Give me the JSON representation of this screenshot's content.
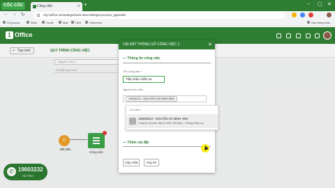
{
  "browser": {
    "brand": "CỐC CỐC",
    "tab_title": "Công việc",
    "url": "nhj.1office.vn/settings/work-new-settings-process_type/add",
    "bookmarks": [
      "Ứng dụng",
      "Work",
      "Gmail",
      "Mail",
      "HKD",
      "Hokoneon",
      "Dấu trang khác"
    ]
  },
  "app": {
    "logo_text": "Office",
    "logo_mark": "1"
  },
  "toolbar": {
    "new_label": "Tạo mới",
    "process_title": "QUY TRÌNH CÔNG VIỆC"
  },
  "canvas": {
    "left_field_placeholder": "Nguyễn Văn A",
    "left_note": "Cài đặt quy trình*",
    "start_node_label": "Bắt đầu",
    "task_node_label": "Công việc"
  },
  "hotline": {
    "number": "19003232",
    "label": "HỖ TRỢ"
  },
  "modal": {
    "title": "CÀI ĐẶT THÔNG SỐ CÔNG VIỆC 1",
    "section_info": "— Thông tin công việc",
    "name_label": "Tên công việc *",
    "name_value": "Tiếp nhận nhân sự",
    "assignee_label": "Người thực hiện",
    "assignee_tag": "19000313 - NGUYỄN HÀ MINH ÁNH",
    "dropdown_header": "Tìm kiếm",
    "dropdown_item_name": "190000313 - NGUYỄN HÀ MINH ÁNH",
    "dropdown_item_org": "Công ty cổ phần đầu tư NID Việt Nam - Phòng Nhân sự",
    "section_more": "— Thêm cài đặt",
    "update_button": "Cập nhật",
    "cancel_button": "Hủy bỏ"
  }
}
